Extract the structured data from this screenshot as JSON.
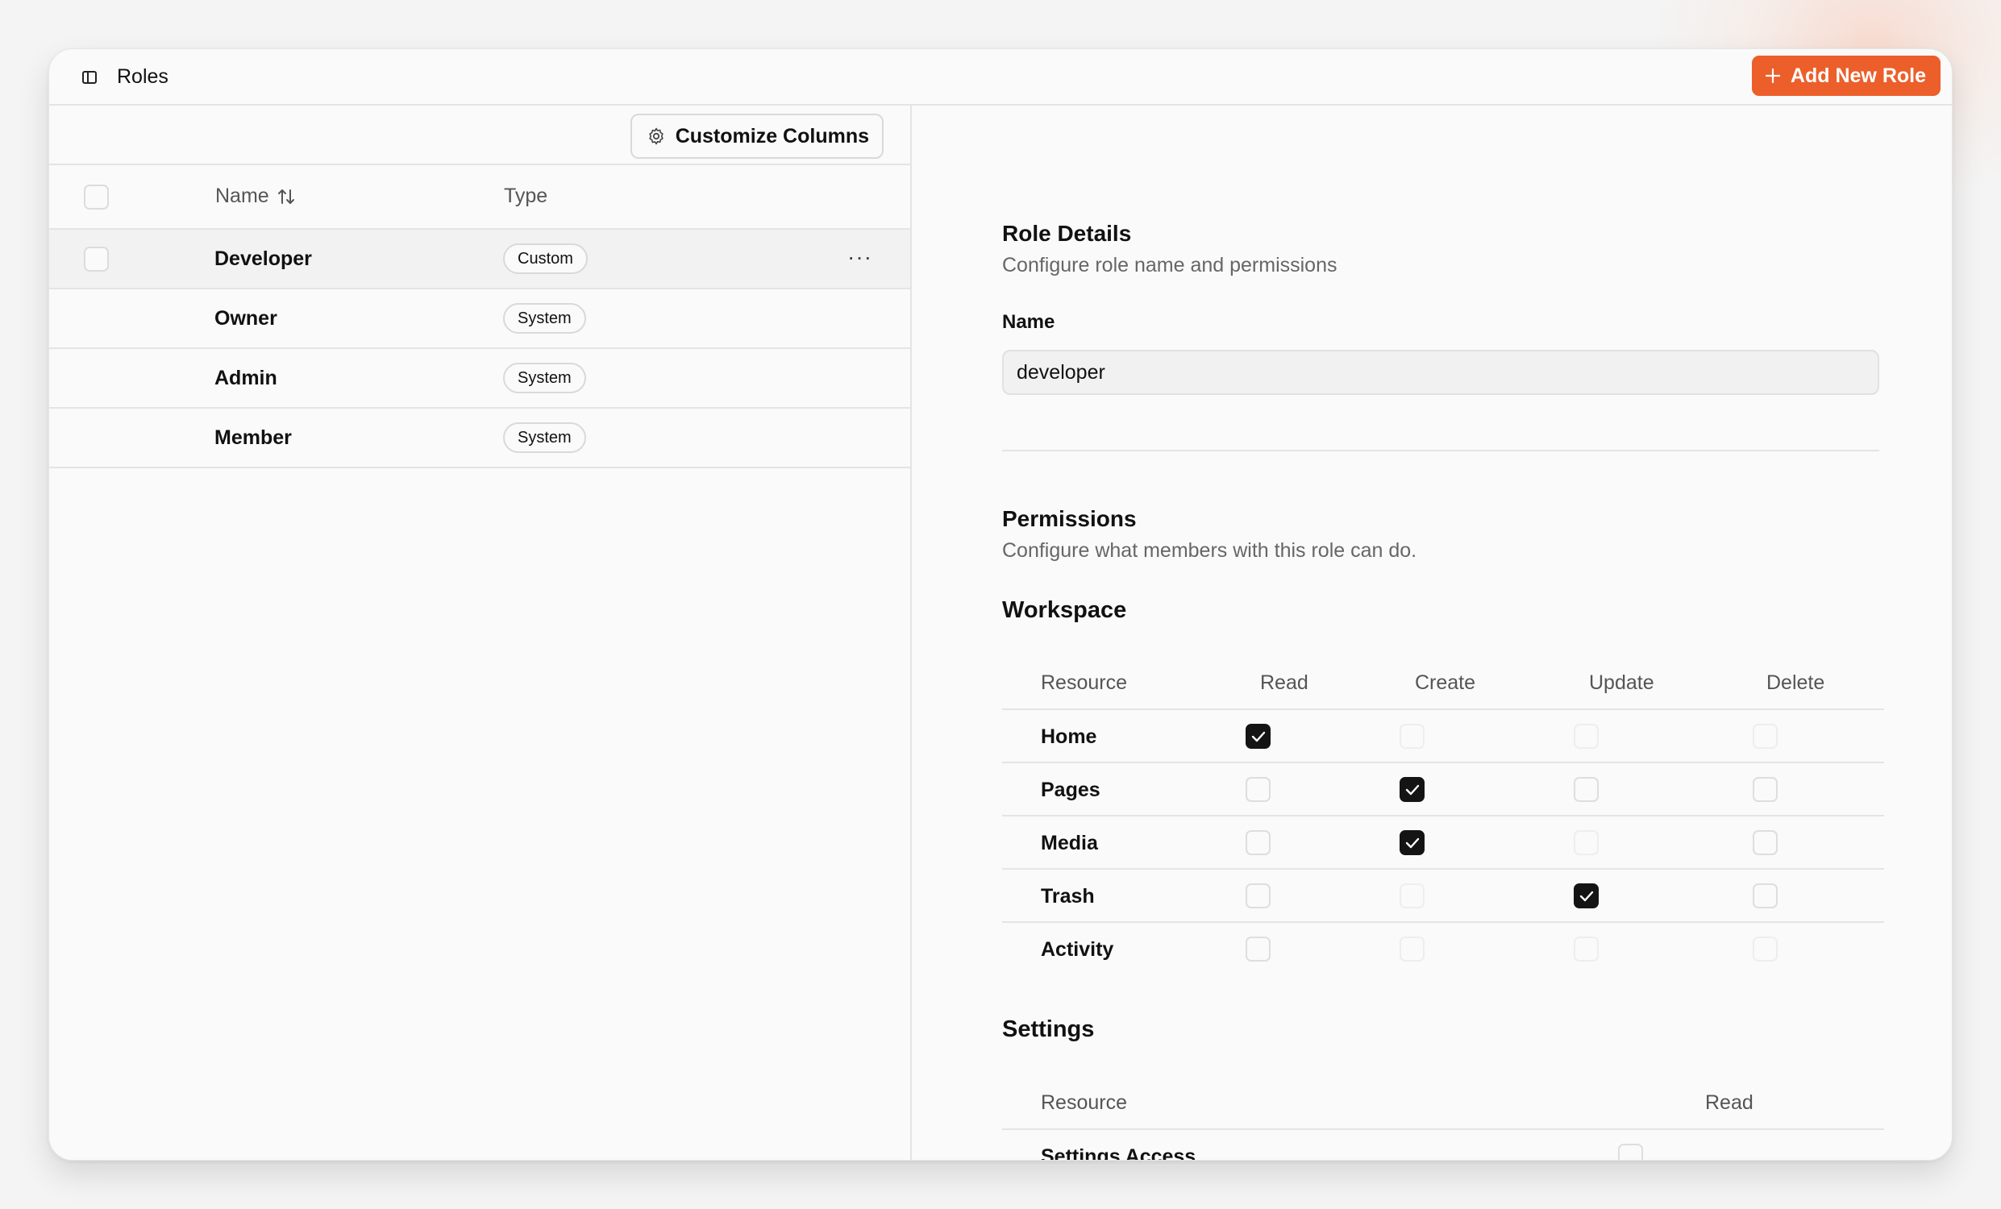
{
  "window": {
    "title": "Roles",
    "add_button_label": "Add New Role"
  },
  "toolbar": {
    "customize_label": "Customize Columns"
  },
  "table": {
    "columns": {
      "name": "Name",
      "type": "Type"
    },
    "rows": [
      {
        "name": "Developer",
        "type": "Custom"
      },
      {
        "name": "Owner",
        "type": "System"
      },
      {
        "name": "Admin",
        "type": "System"
      },
      {
        "name": "Member",
        "type": "System"
      }
    ],
    "row_menu": "···"
  },
  "details": {
    "title": "Role Details",
    "subtitle": "Configure role name and permissions",
    "name_label": "Name",
    "name_value": "developer"
  },
  "permissions": {
    "title": "Permissions",
    "subtitle": "Configure what members with this role can do.",
    "workspace": {
      "title": "Workspace",
      "columns": [
        "Resource",
        "Read",
        "Create",
        "Update",
        "Delete"
      ],
      "rows": [
        {
          "resource": "Home",
          "read": true,
          "create": false,
          "update": false,
          "delete": false
        },
        {
          "resource": "Pages",
          "read": false,
          "create": true,
          "update": false,
          "delete": false
        },
        {
          "resource": "Media",
          "read": false,
          "create": true,
          "update": false,
          "delete": false
        },
        {
          "resource": "Trash",
          "read": false,
          "create": false,
          "update": true,
          "delete": false
        },
        {
          "resource": "Activity",
          "read": false,
          "create": false,
          "update": false,
          "delete": false
        }
      ]
    },
    "settings": {
      "title": "Settings",
      "columns": [
        "Resource",
        "Read"
      ],
      "rows": [
        {
          "resource": "Settings Access",
          "read": false
        }
      ]
    }
  },
  "colors": {
    "accent": "#ec5f2a",
    "checked": "#141414",
    "border": "#e4e4e4"
  }
}
